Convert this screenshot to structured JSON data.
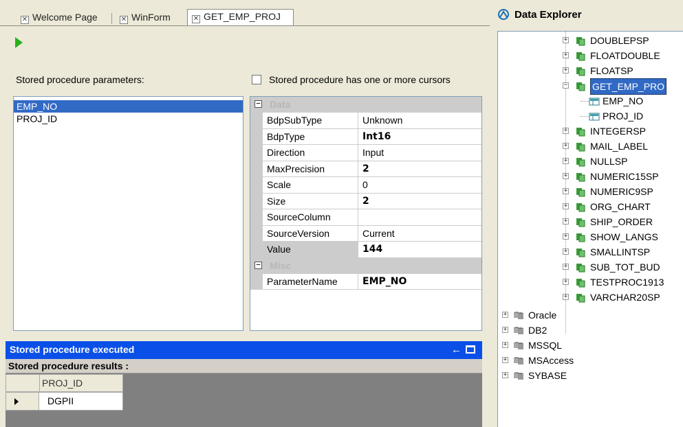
{
  "tabs": [
    {
      "label": "Welcome Page"
    },
    {
      "label": "WinForm"
    },
    {
      "label": "GET_EMP_PROJ"
    }
  ],
  "params_label": "Stored procedure parameters:",
  "cursor_label": "Stored procedure has one or more cursors",
  "parameters": [
    "EMP_NO",
    "PROJ_ID"
  ],
  "property_grid": {
    "cat_data": "Data",
    "cat_misc": "Misc",
    "rows": [
      {
        "name": "BdpSubType",
        "value": "Unknown"
      },
      {
        "name": "BdpType",
        "value": "Int16"
      },
      {
        "name": "Direction",
        "value": "Input"
      },
      {
        "name": "MaxPrecision",
        "value": "2"
      },
      {
        "name": "Scale",
        "value": "0"
      },
      {
        "name": "Size",
        "value": "2"
      },
      {
        "name": "SourceColumn",
        "value": ""
      },
      {
        "name": "SourceVersion",
        "value": "Current"
      },
      {
        "name": "Value",
        "value": "144"
      }
    ],
    "misc_rows": [
      {
        "name": "ParameterName",
        "value": "EMP_NO"
      }
    ]
  },
  "exec_panel": {
    "title": "Stored procedure executed",
    "results_label": "Stored procedure results :",
    "column": "PROJ_ID",
    "cell": "DGPII"
  },
  "explorer": {
    "title": "Data Explorer",
    "procs": [
      "DOUBLEPSP",
      "FLOATDOUBLE",
      "FLOATSP",
      "GET_EMP_PRO",
      "INTEGERSP",
      "MAIL_LABEL",
      "NULLSP",
      "NUMERIC15SP",
      "NUMERIC9SP",
      "ORG_CHART",
      "SHIP_ORDER",
      "SHOW_LANGS",
      "SMALLINTSP",
      "SUB_TOT_BUD",
      "TESTPROC1913",
      "VARCHAR20SP"
    ],
    "children": [
      "EMP_NO",
      "PROJ_ID"
    ],
    "providers": [
      "Oracle",
      "DB2",
      "MSSQL",
      "MSAccess",
      "SYBASE"
    ]
  },
  "colors": {
    "selection": "#316ac5",
    "exec_bar": "#0a50e8",
    "run_icon": "#29b01d"
  }
}
